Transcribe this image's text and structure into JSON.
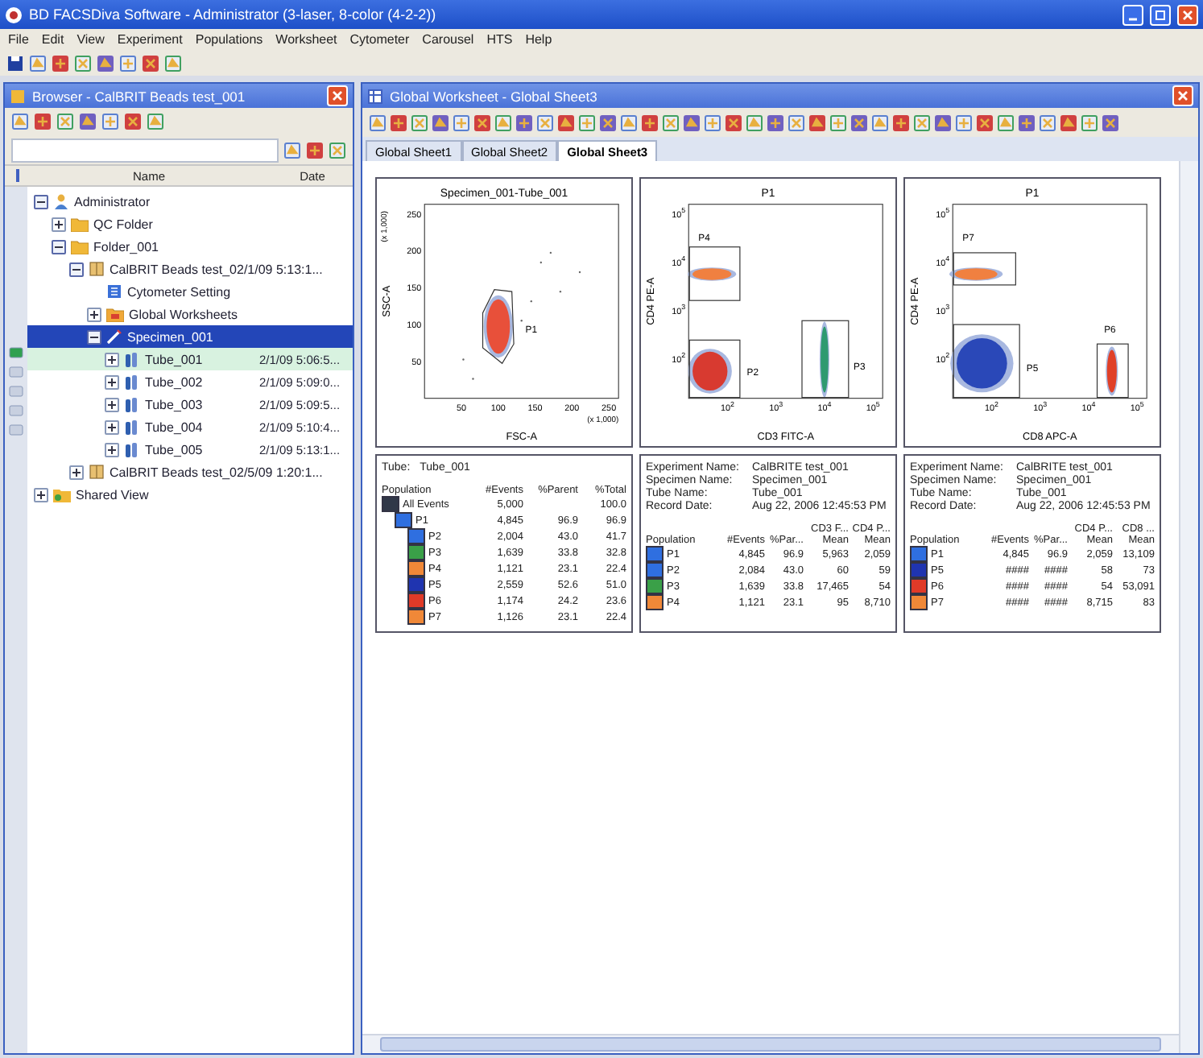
{
  "window": {
    "title": "BD FACSDiva Software - Administrator (3-laser, 8-color (4-2-2))"
  },
  "menu": [
    "File",
    "Edit",
    "View",
    "Experiment",
    "Populations",
    "Worksheet",
    "Cytometer",
    "Carousel",
    "HTS",
    "Help"
  ],
  "browser": {
    "title": "Browser - CalBRIT Beads test_001",
    "columns": [
      "Name",
      "Date"
    ],
    "tree": [
      {
        "name": "Administrator",
        "kind": "user",
        "expanded": true,
        "selected": false,
        "current": false,
        "children": [
          {
            "name": "QC Folder",
            "kind": "folder",
            "expanded": false,
            "selected": false,
            "current": false
          },
          {
            "name": "Folder_001",
            "kind": "folder",
            "expanded": true,
            "selected": false,
            "current": false,
            "children": [
              {
                "name": "CalBRIT Beads test_02/1/09 5:13:1...",
                "kind": "experiment",
                "expanded": true,
                "selected": false,
                "current": false,
                "children": [
                  {
                    "name": "Cytometer Setting",
                    "kind": "settings",
                    "selected": false,
                    "current": false
                  },
                  {
                    "name": "Global Worksheets",
                    "kind": "worksheets",
                    "expanded": false,
                    "selected": false,
                    "current": false
                  },
                  {
                    "name": "Specimen_001",
                    "kind": "specimen",
                    "expanded": true,
                    "selected": true,
                    "current": false,
                    "children": [
                      {
                        "name": "Tube_001",
                        "date": "2/1/09 5:06:5...",
                        "kind": "tube",
                        "expanded": false,
                        "selected": false,
                        "current": true
                      },
                      {
                        "name": "Tube_002",
                        "date": "2/1/09 5:09:0...",
                        "kind": "tube",
                        "expanded": false,
                        "selected": false,
                        "current": false
                      },
                      {
                        "name": "Tube_003",
                        "date": "2/1/09 5:09:5...",
                        "kind": "tube",
                        "expanded": false,
                        "selected": false,
                        "current": false
                      },
                      {
                        "name": "Tube_004",
                        "date": "2/1/09 5:10:4...",
                        "kind": "tube",
                        "expanded": false,
                        "selected": false,
                        "current": false
                      },
                      {
                        "name": "Tube_005",
                        "date": "2/1/09 5:13:1...",
                        "kind": "tube",
                        "expanded": false,
                        "selected": false,
                        "current": false
                      }
                    ]
                  }
                ]
              },
              {
                "name": "CalBRIT Beads test_02/5/09 1:20:1...",
                "kind": "experiment",
                "expanded": false,
                "selected": false,
                "current": false
              }
            ]
          }
        ]
      },
      {
        "name": "Shared View",
        "kind": "shared",
        "expanded": false,
        "selected": false,
        "current": false
      }
    ]
  },
  "worksheet": {
    "title": "Global Worksheet - Global Sheet3",
    "tabs": [
      {
        "label": "Global Sheet1",
        "selected": false
      },
      {
        "label": "Global Sheet2",
        "selected": false
      },
      {
        "label": "Global Sheet3",
        "selected": true
      }
    ],
    "plots": [
      {
        "title": "Specimen_001-Tube_001",
        "xlabel": "FSC-A",
        "ylabel": "SSC-A",
        "xunit": "(x 1,000)",
        "yunit": "(x 1,000)",
        "xticks": [
          {
            "base": "50"
          },
          {
            "base": "100"
          },
          {
            "base": "150"
          },
          {
            "base": "200"
          },
          {
            "base": "250"
          }
        ],
        "yticks": [
          {
            "base": "250"
          },
          {
            "base": "200"
          },
          {
            "base": "150"
          },
          {
            "base": "100"
          },
          {
            "base": "50"
          }
        ],
        "gates": [
          {
            "label": "P1",
            "kind": "polygon",
            "color": "#e8503a"
          }
        ]
      },
      {
        "title": "P1",
        "xlabel": "CD3 FITC-A",
        "ylabel": "CD4 PE-A",
        "xticks": [
          {
            "base": "10",
            "power": "2"
          },
          {
            "base": "10",
            "power": "3"
          },
          {
            "base": "10",
            "power": "4"
          },
          {
            "base": "10",
            "power": "5"
          }
        ],
        "yticks": [
          {
            "base": "10",
            "power": "5"
          },
          {
            "base": "10",
            "power": "4"
          },
          {
            "base": "10",
            "power": "3"
          },
          {
            "base": "10",
            "power": "2"
          }
        ],
        "gates": [
          {
            "label": "P4",
            "kind": "rectangle",
            "color": "#f08040"
          },
          {
            "label": "P2",
            "kind": "rectangle",
            "color": "#d83a30"
          },
          {
            "label": "P3",
            "kind": "rectangle",
            "color": "#2e9a70"
          }
        ]
      },
      {
        "title": "P1",
        "xlabel": "CD8 APC-A",
        "ylabel": "CD4 PE-A",
        "xticks": [
          {
            "base": "10",
            "power": "2"
          },
          {
            "base": "10",
            "power": "3"
          },
          {
            "base": "10",
            "power": "4"
          },
          {
            "base": "10",
            "power": "5"
          }
        ],
        "yticks": [
          {
            "base": "10",
            "power": "5"
          },
          {
            "base": "10",
            "power": "4"
          },
          {
            "base": "10",
            "power": "3"
          },
          {
            "base": "10",
            "power": "2"
          }
        ],
        "gates": [
          {
            "label": "P7",
            "kind": "rectangle",
            "color": "#f08040"
          },
          {
            "label": "P5",
            "kind": "rectangle",
            "color": "#2a48b8"
          },
          {
            "label": "P6",
            "kind": "rectangle",
            "color": "#e04028"
          }
        ]
      }
    ],
    "hierarchy": {
      "tube_label": "Tube:",
      "tube": "Tube_001",
      "population_header": "Population",
      "columns": [
        "#Events",
        "%Parent",
        "%Total"
      ],
      "rows": [
        {
          "name": "All Events",
          "color": "#303848",
          "cells": [
            "5,000",
            "",
            "100.0"
          ],
          "children": [
            {
              "name": "P1",
              "color": "#2f6fe0",
              "cells": [
                "4,845",
                "96.9",
                "96.9"
              ],
              "children": [
                {
                  "name": "P2",
                  "color": "#2f6fe0",
                  "cells": [
                    "2,004",
                    "43.0",
                    "41.7"
                  ]
                },
                {
                  "name": "P3",
                  "color": "#3aa048",
                  "cells": [
                    "1,639",
                    "33.8",
                    "32.8"
                  ]
                },
                {
                  "name": "P4",
                  "color": "#f08838",
                  "cells": [
                    "1,121",
                    "23.1",
                    "22.4"
                  ]
                },
                {
                  "name": "P5",
                  "color": "#1f34b0",
                  "cells": [
                    "2,559",
                    "52.6",
                    "51.0"
                  ]
                },
                {
                  "name": "P6",
                  "color": "#e03a28",
                  "cells": [
                    "1,174",
                    "24.2",
                    "23.6"
                  ]
                },
                {
                  "name": "P7",
                  "color": "#f08838",
                  "cells": [
                    "1,126",
                    "23.1",
                    "22.4"
                  ]
                }
              ]
            }
          ]
        }
      ]
    },
    "stats": [
      {
        "info": [
          {
            "label": "Experiment Name:",
            "value": "CalBRITE test_001"
          },
          {
            "label": "Specimen Name:",
            "value": "Specimen_001"
          },
          {
            "label": "Tube Name:",
            "value": "Tube_001"
          },
          {
            "label": "Record Date:",
            "value": "Aug 22, 2006 12:45:53 PM"
          }
        ],
        "population_header": "Population",
        "columns": [
          {
            "label": "#Events"
          },
          {
            "label": "%Par..."
          },
          {
            "group": "CD3 F...",
            "label": "Mean"
          },
          {
            "group": "CD4 P...",
            "label": "Mean"
          }
        ],
        "rows": [
          {
            "name": "P1",
            "color": "#2f6fe0",
            "cells": [
              "4,845",
              "96.9",
              "5,963",
              "2,059"
            ]
          },
          {
            "name": "P2",
            "color": "#2f6fe0",
            "cells": [
              "2,084",
              "43.0",
              "60",
              "59"
            ]
          },
          {
            "name": "P3",
            "color": "#3aa048",
            "cells": [
              "1,639",
              "33.8",
              "17,465",
              "54"
            ]
          },
          {
            "name": "P4",
            "color": "#f08838",
            "cells": [
              "1,121",
              "23.1",
              "95",
              "8,710"
            ]
          }
        ]
      },
      {
        "info": [
          {
            "label": "Experiment Name:",
            "value": "CalBRITE test_001"
          },
          {
            "label": "Specimen Name:",
            "value": "Specimen_001"
          },
          {
            "label": "Tube Name:",
            "value": "Tube_001"
          },
          {
            "label": "Record Date:",
            "value": "Aug 22, 2006 12:45:53 PM"
          }
        ],
        "population_header": "Population",
        "columns": [
          {
            "label": "#Events"
          },
          {
            "label": "%Par..."
          },
          {
            "group": "CD4 P...",
            "label": "Mean"
          },
          {
            "group": "CD8 ...",
            "label": "Mean"
          }
        ],
        "rows": [
          {
            "name": "P1",
            "color": "#2f6fe0",
            "cells": [
              "4,845",
              "96.9",
              "2,059",
              "13,109"
            ]
          },
          {
            "name": "P5",
            "color": "#1f34b0",
            "cells": [
              "####",
              "####",
              "58",
              "73"
            ]
          },
          {
            "name": "P6",
            "color": "#e03a28",
            "cells": [
              "####",
              "####",
              "54",
              "53,091"
            ]
          },
          {
            "name": "P7",
            "color": "#f08838",
            "cells": [
              "####",
              "####",
              "8,715",
              "83"
            ]
          }
        ]
      }
    ]
  }
}
